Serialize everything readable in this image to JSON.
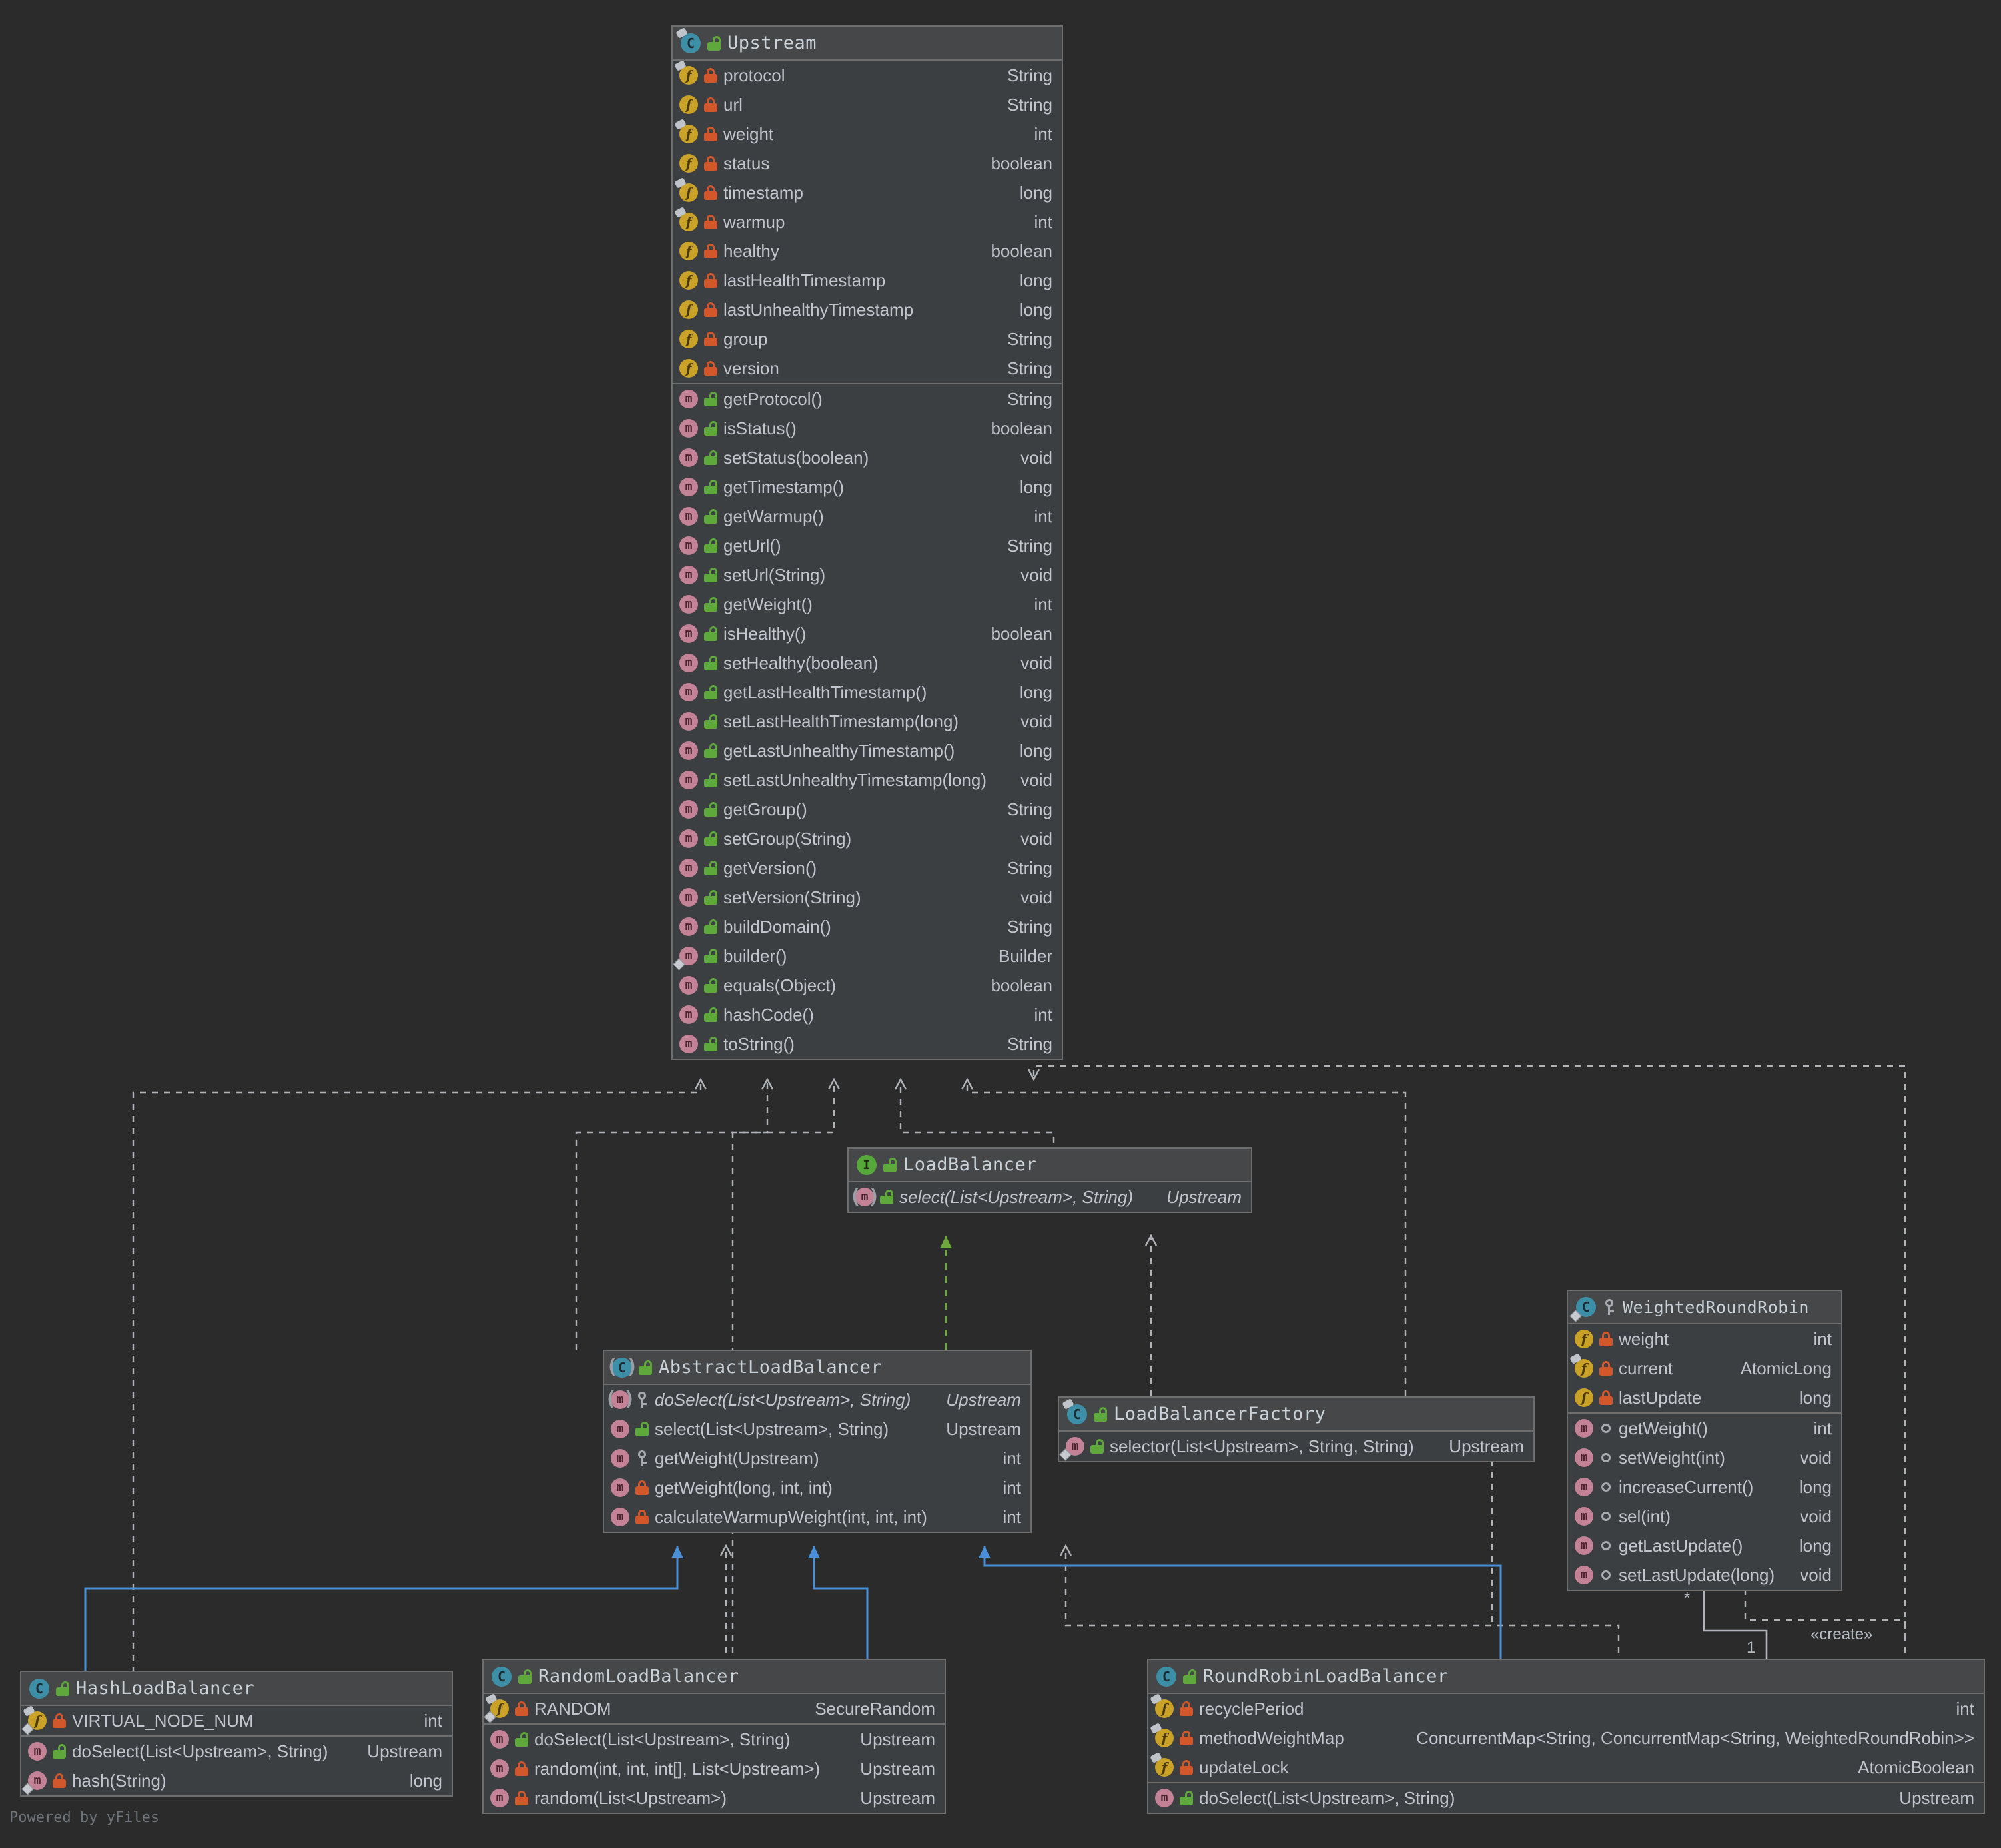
{
  "diagram": {
    "kind": "uml-class-diagram",
    "watermark": "Powered by yFiles",
    "colors": {
      "background": "#2B2B2B",
      "node_body": "#3C3F41",
      "node_header": "#454748",
      "border": "#6E6E6E",
      "text": "#C0C5CE",
      "inheritance_blue": "#4A90D9",
      "realization_green": "#6CA83C",
      "dependency_gray": "#B0B4B8",
      "class_icon": "#3D8FA8",
      "interface_icon": "#57A83A",
      "field_icon": "#C9A227",
      "method_icon": "#C38296",
      "lock_public": "#5FA83B",
      "lock_private": "#D2572B"
    },
    "edge_labels": {
      "create": "«create»",
      "many": "*",
      "one": "1"
    }
  },
  "classes": {
    "upstream": {
      "name": "Upstream",
      "stereotype": "class",
      "visibility": "public",
      "fields": [
        {
          "name": "protocol",
          "type": "String",
          "vis": "private",
          "static": false,
          "pin": true
        },
        {
          "name": "url",
          "type": "String",
          "vis": "private",
          "static": false,
          "pin": false
        },
        {
          "name": "weight",
          "type": "int",
          "vis": "private",
          "static": false,
          "pin": true
        },
        {
          "name": "status",
          "type": "boolean",
          "vis": "private",
          "static": false,
          "pin": false
        },
        {
          "name": "timestamp",
          "type": "long",
          "vis": "private",
          "static": false,
          "pin": true
        },
        {
          "name": "warmup",
          "type": "int",
          "vis": "private",
          "static": false,
          "pin": true
        },
        {
          "name": "healthy",
          "type": "boolean",
          "vis": "private",
          "static": false,
          "pin": false
        },
        {
          "name": "lastHealthTimestamp",
          "type": "long",
          "vis": "private",
          "static": false,
          "pin": false
        },
        {
          "name": "lastUnhealthyTimestamp",
          "type": "long",
          "vis": "private",
          "static": false,
          "pin": false
        },
        {
          "name": "group",
          "type": "String",
          "vis": "private",
          "static": false,
          "pin": false
        },
        {
          "name": "version",
          "type": "String",
          "vis": "private",
          "static": false,
          "pin": false
        }
      ],
      "methods": [
        {
          "name": "getProtocol()",
          "type": "String",
          "vis": "public"
        },
        {
          "name": "isStatus()",
          "type": "boolean",
          "vis": "public"
        },
        {
          "name": "setStatus(boolean)",
          "type": "void",
          "vis": "public"
        },
        {
          "name": "getTimestamp()",
          "type": "long",
          "vis": "public"
        },
        {
          "name": "getWarmup()",
          "type": "int",
          "vis": "public"
        },
        {
          "name": "getUrl()",
          "type": "String",
          "vis": "public"
        },
        {
          "name": "setUrl(String)",
          "type": "void",
          "vis": "public"
        },
        {
          "name": "getWeight()",
          "type": "int",
          "vis": "public"
        },
        {
          "name": "isHealthy()",
          "type": "boolean",
          "vis": "public"
        },
        {
          "name": "setHealthy(boolean)",
          "type": "void",
          "vis": "public"
        },
        {
          "name": "getLastHealthTimestamp()",
          "type": "long",
          "vis": "public"
        },
        {
          "name": "setLastHealthTimestamp(long)",
          "type": "void",
          "vis": "public"
        },
        {
          "name": "getLastUnhealthyTimestamp()",
          "type": "long",
          "vis": "public"
        },
        {
          "name": "setLastUnhealthyTimestamp(long)",
          "type": "void",
          "vis": "public"
        },
        {
          "name": "getGroup()",
          "type": "String",
          "vis": "public"
        },
        {
          "name": "setGroup(String)",
          "type": "void",
          "vis": "public"
        },
        {
          "name": "getVersion()",
          "type": "String",
          "vis": "public"
        },
        {
          "name": "setVersion(String)",
          "type": "void",
          "vis": "public"
        },
        {
          "name": "buildDomain()",
          "type": "String",
          "vis": "public"
        },
        {
          "name": "builder()",
          "type": "Builder",
          "vis": "public",
          "static": true
        },
        {
          "name": "equals(Object)",
          "type": "boolean",
          "vis": "public"
        },
        {
          "name": "hashCode()",
          "type": "int",
          "vis": "public"
        },
        {
          "name": "toString()",
          "type": "String",
          "vis": "public"
        }
      ]
    },
    "loadBalancer": {
      "name": "LoadBalancer",
      "stereotype": "interface",
      "visibility": "public",
      "fields": [],
      "methods": [
        {
          "name": "select(List<Upstream>, String)",
          "type": "Upstream",
          "vis": "public",
          "abstract": true
        }
      ]
    },
    "abstractLoadBalancer": {
      "name": "AbstractLoadBalancer",
      "stereotype": "abstract-class",
      "visibility": "public",
      "fields": [],
      "methods": [
        {
          "name": "doSelect(List<Upstream>, String)",
          "type": "Upstream",
          "vis": "protected",
          "abstract": true
        },
        {
          "name": "select(List<Upstream>, String)",
          "type": "Upstream",
          "vis": "public"
        },
        {
          "name": "getWeight(Upstream)",
          "type": "int",
          "vis": "protected"
        },
        {
          "name": "getWeight(long, int, int)",
          "type": "int",
          "vis": "private"
        },
        {
          "name": "calculateWarmupWeight(int, int, int)",
          "type": "int",
          "vis": "private"
        }
      ]
    },
    "loadBalancerFactory": {
      "name": "LoadBalancerFactory",
      "stereotype": "class",
      "visibility": "public",
      "fields": [],
      "methods": [
        {
          "name": "selector(List<Upstream>, String, String)",
          "type": "Upstream",
          "vis": "public",
          "static": true
        }
      ]
    },
    "weightedRoundRobin": {
      "name": "WeightedRoundRobin",
      "stereotype": "inner-class",
      "visibility": "protected",
      "fields": [
        {
          "name": "weight",
          "type": "int",
          "vis": "private",
          "pin": false
        },
        {
          "name": "current",
          "type": "AtomicLong",
          "vis": "private",
          "pin": true
        },
        {
          "name": "lastUpdate",
          "type": "long",
          "vis": "private",
          "pin": false
        }
      ],
      "methods": [
        {
          "name": "getWeight()",
          "type": "int",
          "vis": "package"
        },
        {
          "name": "setWeight(int)",
          "type": "void",
          "vis": "package"
        },
        {
          "name": "increaseCurrent()",
          "type": "long",
          "vis": "package"
        },
        {
          "name": "sel(int)",
          "type": "void",
          "vis": "package"
        },
        {
          "name": "getLastUpdate()",
          "type": "long",
          "vis": "package"
        },
        {
          "name": "setLastUpdate(long)",
          "type": "void",
          "vis": "package"
        }
      ]
    },
    "hashLoadBalancer": {
      "name": "HashLoadBalancer",
      "stereotype": "class",
      "visibility": "public",
      "fields": [
        {
          "name": "VIRTUAL_NODE_NUM",
          "type": "int",
          "vis": "private",
          "static": true,
          "pin": true
        }
      ],
      "methods": [
        {
          "name": "doSelect(List<Upstream>, String)",
          "type": "Upstream",
          "vis": "public"
        },
        {
          "name": "hash(String)",
          "type": "long",
          "vis": "private",
          "static": true
        }
      ]
    },
    "randomLoadBalancer": {
      "name": "RandomLoadBalancer",
      "stereotype": "class",
      "visibility": "public",
      "fields": [
        {
          "name": "RANDOM",
          "type": "SecureRandom",
          "vis": "private",
          "static": true,
          "pin": true
        }
      ],
      "methods": [
        {
          "name": "doSelect(List<Upstream>, String)",
          "type": "Upstream",
          "vis": "public"
        },
        {
          "name": "random(int, int, int[], List<Upstream>)",
          "type": "Upstream",
          "vis": "private"
        },
        {
          "name": "random(List<Upstream>)",
          "type": "Upstream",
          "vis": "private"
        }
      ]
    },
    "roundRobinLoadBalancer": {
      "name": "RoundRobinLoadBalancer",
      "stereotype": "class",
      "visibility": "public",
      "fields": [
        {
          "name": "recyclePeriod",
          "type": "int",
          "vis": "private",
          "static": true,
          "pin": true
        },
        {
          "name": "methodWeightMap",
          "type": "ConcurrentMap<String, ConcurrentMap<String, WeightedRoundRobin>>",
          "vis": "private",
          "static": true,
          "pin": true
        },
        {
          "name": "updateLock",
          "type": "AtomicBoolean",
          "vis": "private",
          "static": true,
          "pin": true
        }
      ],
      "methods": [
        {
          "name": "doSelect(List<Upstream>, String)",
          "type": "Upstream",
          "vis": "public"
        }
      ]
    }
  }
}
